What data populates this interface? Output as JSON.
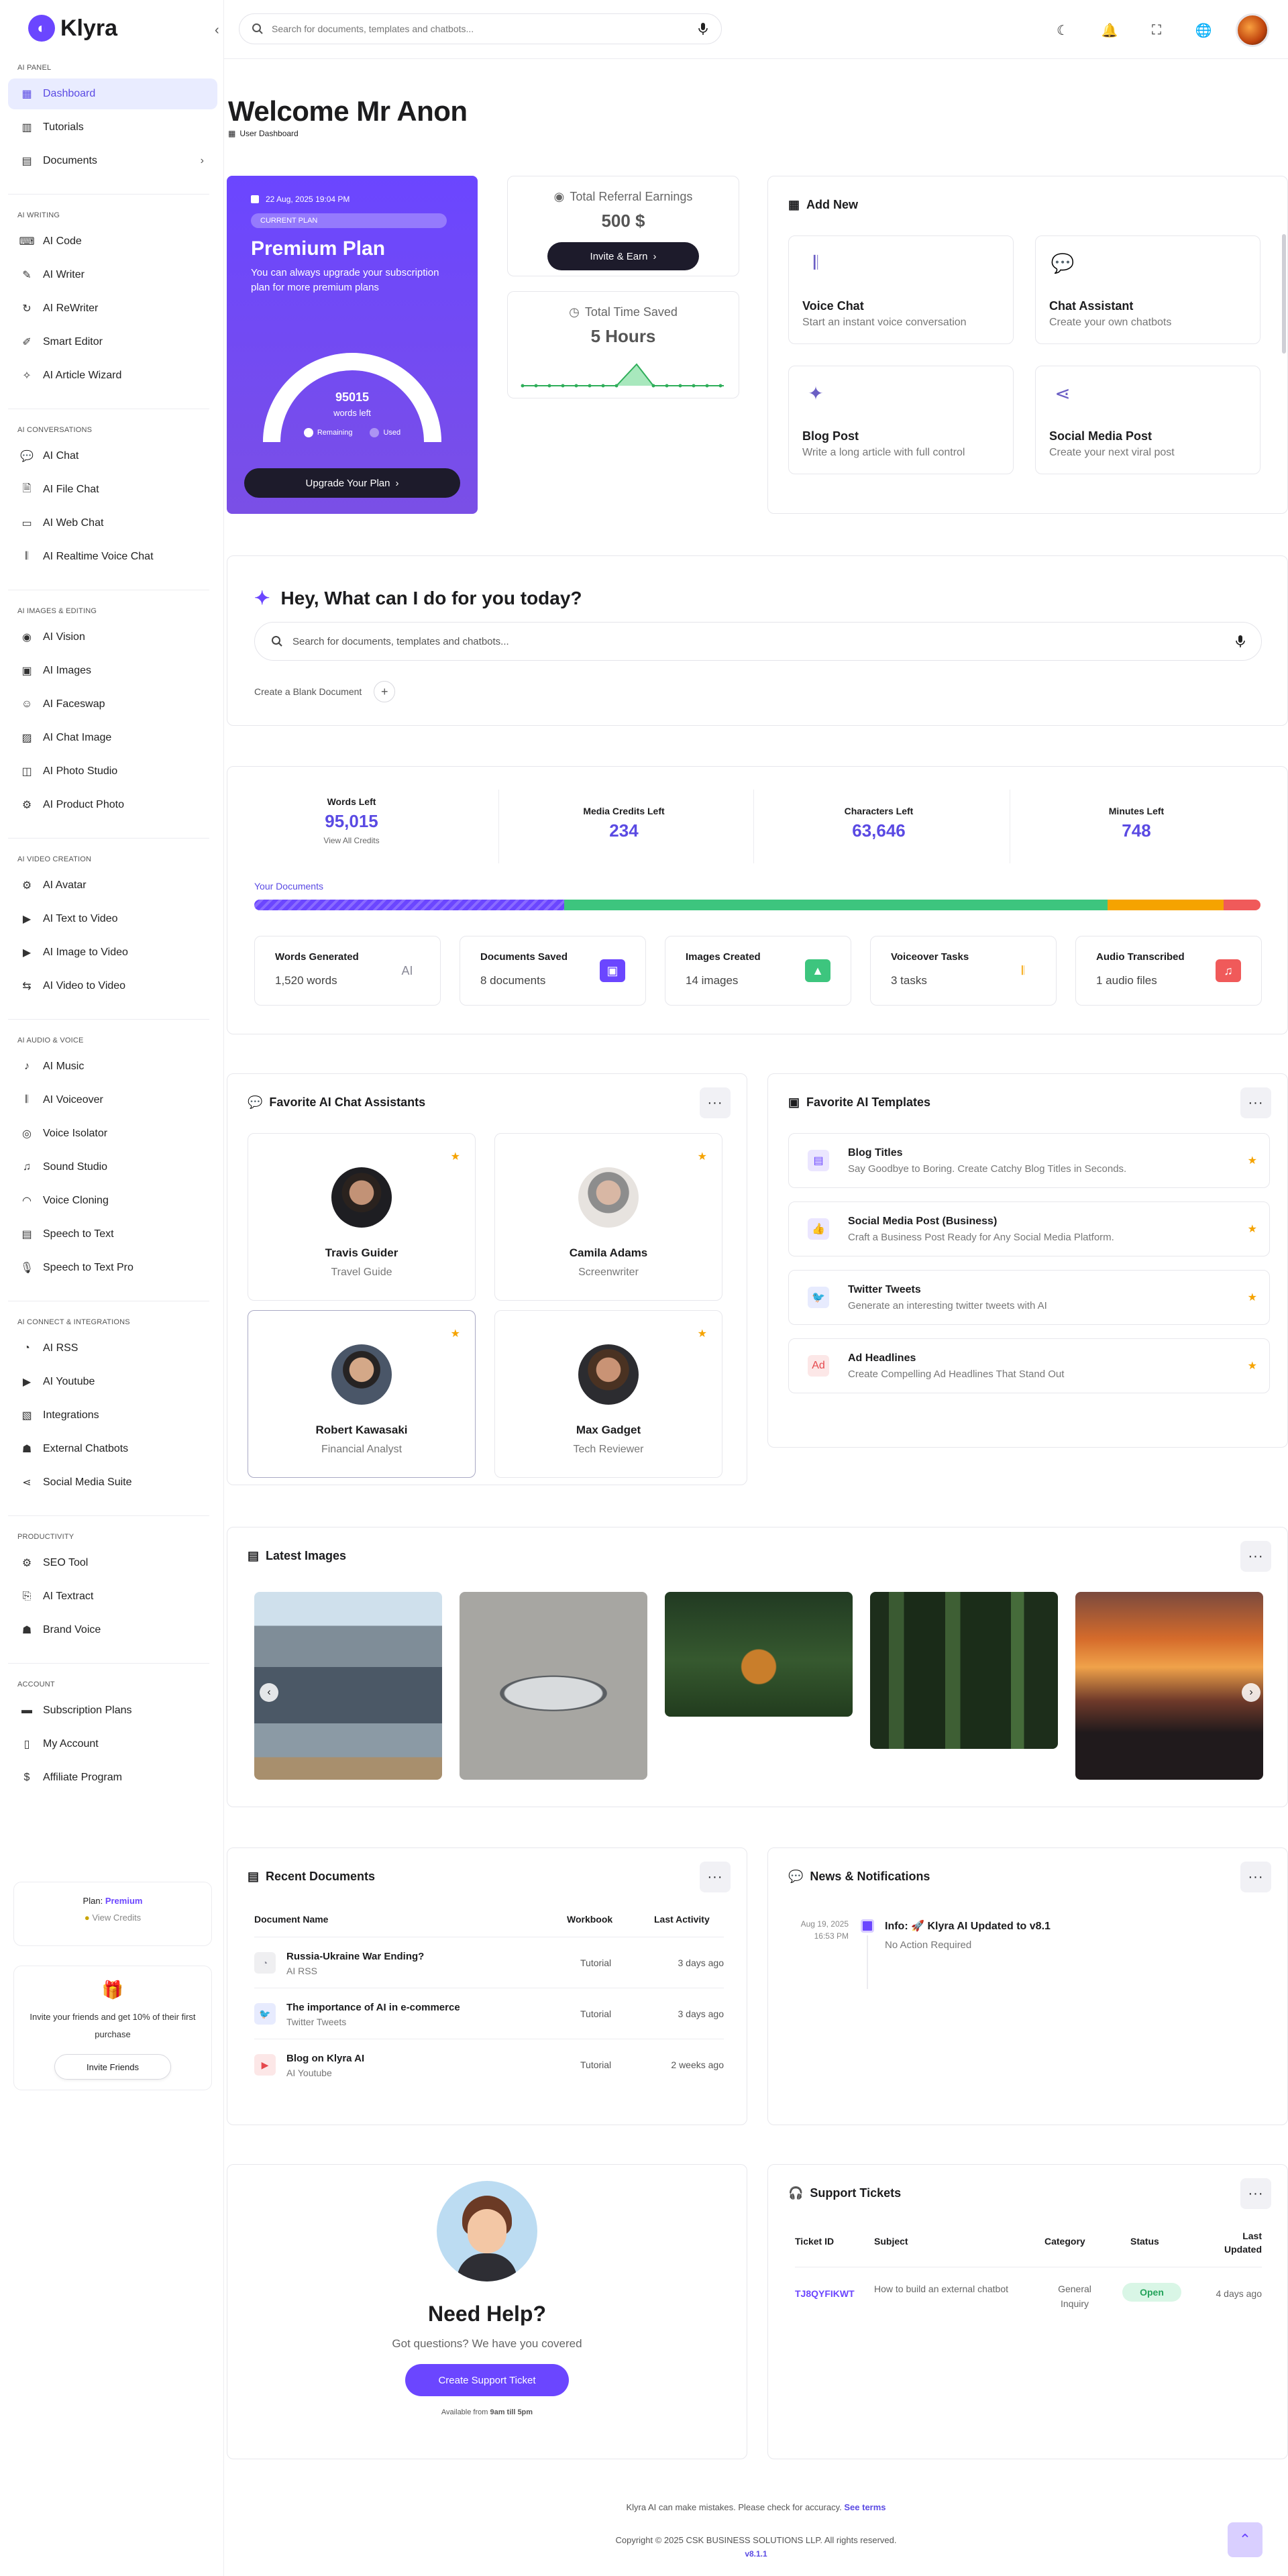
{
  "app": {
    "name": "Klyra"
  },
  "search": {
    "placeholder": "Search for documents, templates and chatbots..."
  },
  "sidebar": {
    "sections": [
      {
        "title": "AI PANEL",
        "items": [
          "Dashboard",
          "Tutorials",
          "Documents"
        ]
      },
      {
        "title": "AI WRITING",
        "items": [
          "AI Code",
          "AI Writer",
          "AI ReWriter",
          "Smart Editor",
          "AI Article Wizard"
        ]
      },
      {
        "title": "AI CONVERSATIONS",
        "items": [
          "AI Chat",
          "AI File Chat",
          "AI Web Chat",
          "AI Realtime Voice Chat"
        ]
      },
      {
        "title": "AI IMAGES & EDITING",
        "items": [
          "AI Vision",
          "AI Images",
          "AI Faceswap",
          "AI Chat Image",
          "AI Photo Studio",
          "AI Product Photo"
        ]
      },
      {
        "title": "AI VIDEO CREATION",
        "items": [
          "AI Avatar",
          "AI Text to Video",
          "AI Image to Video",
          "AI Video to Video"
        ]
      },
      {
        "title": "AI AUDIO & VOICE",
        "items": [
          "AI Music",
          "AI Voiceover",
          "Voice Isolator",
          "Sound Studio",
          "Voice Cloning",
          "Speech to Text",
          "Speech to Text Pro"
        ]
      },
      {
        "title": "AI CONNECT & INTEGRATIONS",
        "items": [
          "AI RSS",
          "AI Youtube",
          "Integrations",
          "External Chatbots",
          "Social Media Suite"
        ]
      },
      {
        "title": "PRODUCTIVITY",
        "items": [
          "SEO Tool",
          "AI Textract",
          "Brand Voice"
        ]
      },
      {
        "title": "ACCOUNT",
        "items": [
          "Subscription Plans",
          "My Account",
          "Affiliate Program"
        ]
      }
    ],
    "plan_label": "Plan:",
    "plan_name": "Premium",
    "view_credits": "View Credits",
    "invite_text": "Invite your friends and get 10% of their first purchase",
    "invite_button": "Invite Friends"
  },
  "header": {
    "title": "Welcome Mr Anon",
    "breadcrumb": "User Dashboard"
  },
  "plan_card": {
    "date": "22 Aug, 2025 19:04 PM",
    "badge": "CURRENT PLAN",
    "title": "Premium Plan",
    "desc": "You can always upgrade your subscription plan for more premium plans",
    "words_value": "95015",
    "words_label": "words left",
    "remaining": "Remaining",
    "used": "Used",
    "remaining_fraction": 1.0,
    "upgrade_button": "Upgrade Your Plan"
  },
  "referral": {
    "label": "Total Referral Earnings",
    "value": "500 $",
    "button": "Invite & Earn"
  },
  "time_saved": {
    "label": "Total Time Saved",
    "value": "5 Hours"
  },
  "add_new": {
    "title": "Add New",
    "tiles": [
      {
        "title": "Voice Chat",
        "desc": "Start an instant voice conversation",
        "icon": "waveform-icon"
      },
      {
        "title": "Chat Assistant",
        "desc": "Create your own chatbots",
        "icon": "chat-icon"
      },
      {
        "title": "Blog Post",
        "desc": "Write a long article with full control",
        "icon": "sparkle-icon"
      },
      {
        "title": "Social Media Post",
        "desc": "Create your next viral post",
        "icon": "share-icon"
      }
    ]
  },
  "assistant": {
    "title": "Hey, What can I do for you today?",
    "placeholder": "Search for documents, templates and chatbots...",
    "blank_doc": "Create a Blank Document"
  },
  "usage": {
    "stats": [
      {
        "label": "Words Left",
        "value": "95,015",
        "action": "View All Credits"
      },
      {
        "label": "Media Credits Left",
        "value": "234"
      },
      {
        "label": "Characters Left",
        "value": "63,646"
      },
      {
        "label": "Minutes Left",
        "value": "748"
      }
    ],
    "docs_label": "Your Documents",
    "bar": [
      {
        "color": "#6b46ff",
        "share": 0.308,
        "striped": true
      },
      {
        "color": "#3dc57e",
        "share": 0.54
      },
      {
        "color": "#f5a300",
        "share": 0.115
      },
      {
        "color": "#f05a5a",
        "share": 0.037
      }
    ],
    "tiles": [
      {
        "title": "Words Generated",
        "value": "1,520 words",
        "color": "#8a8a98",
        "icon": "chip-icon"
      },
      {
        "title": "Documents Saved",
        "value": "8 documents",
        "color": "#6b46ff",
        "icon": "folder-icon"
      },
      {
        "title": "Images Created",
        "value": "14 images",
        "color": "#3dc57e",
        "icon": "image-icon"
      },
      {
        "title": "Voiceover Tasks",
        "value": "3 tasks",
        "color": "#f5a300",
        "icon": "waveform-icon"
      },
      {
        "title": "Audio Transcribed",
        "value": "1 audio files",
        "color": "#f05a5a",
        "icon": "music-icon"
      }
    ]
  },
  "fav_chat": {
    "title": "Favorite AI Chat Assistants",
    "people": [
      {
        "name": "Travis Guider",
        "role": "Travel Guide"
      },
      {
        "name": "Camila Adams",
        "role": "Screenwriter"
      },
      {
        "name": "Robert Kawasaki",
        "role": "Financial Analyst"
      },
      {
        "name": "Max Gadget",
        "role": "Tech Reviewer"
      }
    ]
  },
  "fav_templates": {
    "title": "Favorite AI Templates",
    "items": [
      {
        "title": "Blog Titles",
        "desc": "Say Goodbye to Boring. Create Catchy Blog Titles in Seconds.",
        "color": "#6b46ff",
        "icon": "chat-icon"
      },
      {
        "title": "Social Media Post (Business)",
        "desc": "Craft a Business Post Ready for Any Social Media Platform.",
        "color": "#6b46ff",
        "icon": "thumbs-up-icon"
      },
      {
        "title": "Twitter Tweets",
        "desc": "Generate an interesting twitter tweets with AI",
        "color": "#4a6cf7",
        "icon": "twitter-icon"
      },
      {
        "title": "Ad Headlines",
        "desc": "Create Compelling Ad Headlines That Stand Out",
        "color": "#e5484d",
        "icon": "ad-icon"
      }
    ]
  },
  "latest_images": {
    "title": "Latest Images"
  },
  "recent_docs": {
    "title": "Recent Documents",
    "columns": [
      "Document Name",
      "Workbook",
      "Last Activity"
    ],
    "rows": [
      {
        "name": "Russia-Ukraine War Ending?",
        "category": "AI RSS",
        "workbook": "Tutorial",
        "time": "3 days ago",
        "color": "#8a8a98",
        "icon": "rss-icon"
      },
      {
        "name": "The importance of AI in e-commerce",
        "category": "Twitter Tweets",
        "workbook": "Tutorial",
        "time": "3 days ago",
        "color": "#4a6cf7",
        "icon": "twitter-icon"
      },
      {
        "name": "Blog on Klyra AI",
        "category": "AI Youtube",
        "workbook": "Tutorial",
        "time": "2 weeks ago",
        "color": "#e5484d",
        "icon": "youtube-icon"
      }
    ]
  },
  "news": {
    "title": "News & Notifications",
    "date": "Aug 19, 2025",
    "time": "16:53 PM",
    "headline": "Info: 🚀 Klyra AI Updated to v8.1",
    "status": "No Action Required"
  },
  "help": {
    "title": "Need Help?",
    "subtitle": "Got questions? We have you covered",
    "button": "Create Support Ticket",
    "available": "Available from",
    "hours": "9am till 5pm"
  },
  "tickets": {
    "title": "Support Tickets",
    "columns": [
      "Ticket ID",
      "Subject",
      "Category",
      "Status",
      "Last Updated"
    ],
    "row": {
      "id": "TJ8QYFIKWT",
      "subject": "How to build an external chatbot",
      "category": "General Inquiry",
      "status": "Open",
      "time": "4 days ago"
    }
  },
  "footer": {
    "disclaimer": "Klyra AI can make mistakes. Please check for accuracy.",
    "terms": "See terms",
    "copyright": "Copyright © 2025 CSK BUSINESS SOLUTIONS LLP. All rights reserved.",
    "version": "v8.1.1"
  }
}
